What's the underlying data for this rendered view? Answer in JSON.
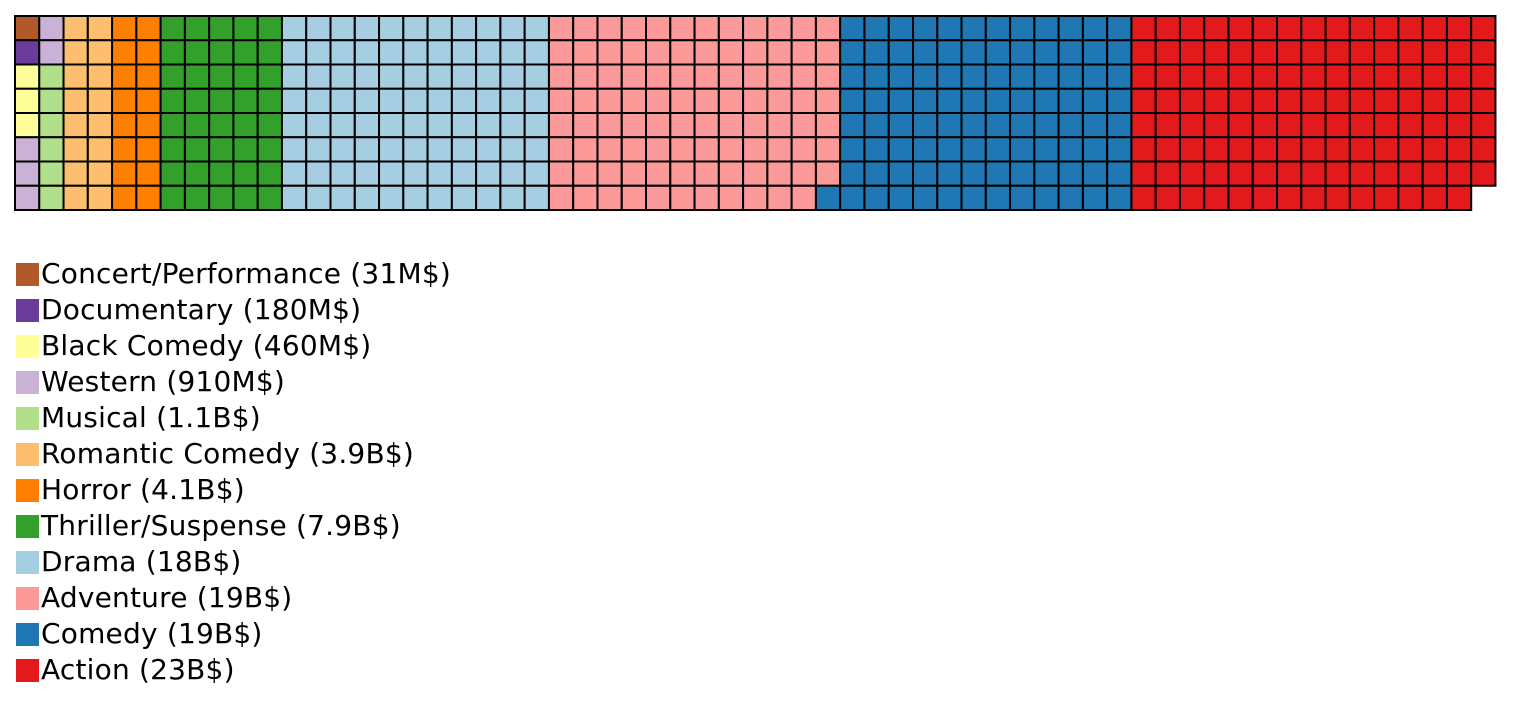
{
  "chart_data": {
    "type": "waffle",
    "grid": {
      "rows": 8,
      "columns": 61
    },
    "cell_border_color": "#000000",
    "series": [
      {
        "name": "Concert/Performance",
        "value_label": "31M$",
        "color": "#b15928",
        "cells": 1
      },
      {
        "name": "Documentary",
        "value_label": "180M$",
        "color": "#6a3d9a",
        "cells": 1
      },
      {
        "name": "Black Comedy",
        "value_label": "460M$",
        "color": "#ffff99",
        "cells": 3
      },
      {
        "name": "Western",
        "value_label": "910M$",
        "color": "#cab2d6",
        "cells": 5
      },
      {
        "name": "Musical",
        "value_label": "1.1B$",
        "color": "#b2df8a",
        "cells": 6
      },
      {
        "name": "Romantic Comedy",
        "value_label": "3.9B$",
        "color": "#fdbf6f",
        "cells": 16
      },
      {
        "name": "Horror",
        "value_label": "4.1B$",
        "color": "#ff7f00",
        "cells": 16
      },
      {
        "name": "Thriller/Suspense",
        "value_label": "7.9B$",
        "color": "#33a02c",
        "cells": 40
      },
      {
        "name": "Drama",
        "value_label": "18B$",
        "color": "#a6cee3",
        "cells": 88
      },
      {
        "name": "Adventure",
        "value_label": "19B$",
        "color": "#fb9a99",
        "cells": 95
      },
      {
        "name": "Comedy",
        "value_label": "19B$",
        "color": "#1f78b4",
        "cells": 97
      },
      {
        "name": "Action",
        "value_label": "23B$",
        "color": "#e31a1c",
        "cells": 119
      }
    ]
  }
}
